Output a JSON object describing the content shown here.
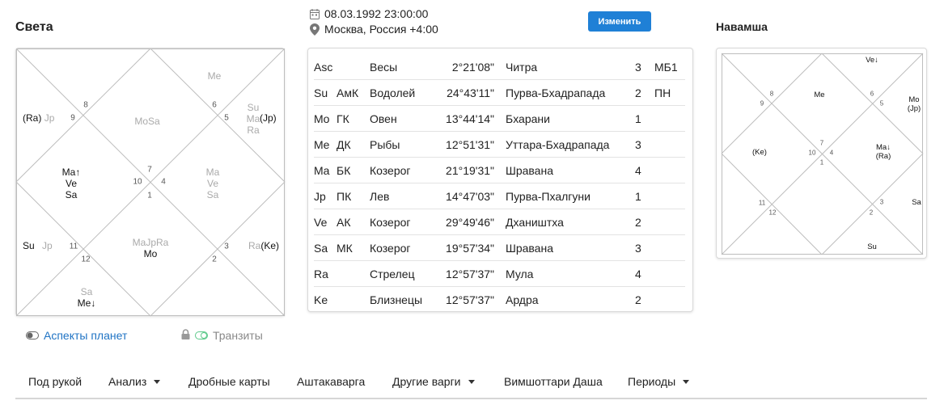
{
  "rasi": {
    "title": "Света",
    "houses": [
      {
        "num": "1",
        "planets": [
          {
            "t": "Ma↑",
            "dim": false
          },
          {
            "t": "Ve",
            "dim": false
          },
          {
            "t": "Sa",
            "dim": false
          }
        ]
      },
      {
        "num": "2",
        "planets": []
      },
      {
        "num": "3",
        "planets": []
      },
      {
        "num": "4",
        "planets": [
          {
            "t": "Ma",
            "dim": true
          },
          {
            "t": "Ve",
            "dim": true
          },
          {
            "t": "Sa",
            "dim": true
          }
        ]
      },
      {
        "num": "5",
        "planets": [
          {
            "t": "Su",
            "dim": true
          },
          {
            "t": "Ma",
            "dim": true
          },
          {
            "t": "Ra",
            "dim": true
          }
        ]
      },
      {
        "num": "6",
        "planets": [
          {
            "t": "Me",
            "dim": true
          }
        ]
      },
      {
        "num": "7",
        "planets": [
          {
            "t": "MoSa",
            "dim": true
          }
        ]
      },
      {
        "num": "8",
        "planets": []
      },
      {
        "num": "9",
        "planets": []
      },
      {
        "num": "10",
        "planets": []
      },
      {
        "num": "11",
        "planets": []
      },
      {
        "num": "12",
        "planets": [
          {
            "t": "Sa",
            "dim": true
          },
          {
            "t": "Me↓",
            "dim": false
          }
        ]
      },
      {
        "num": "",
        "planets": [
          {
            "t": "MaJpRa",
            "dim": true
          },
          {
            "t": "Mo",
            "dim": false
          }
        ]
      }
    ],
    "side": {
      "l1": "(Ra)",
      "l1b": "Jp",
      "r1": "(Jp)",
      "l2": "Su",
      "l2b": "Jp",
      "r2a": "Ra",
      "r2": "(Ke)"
    }
  },
  "birth": {
    "datetime": "08.03.1992 23:00:00",
    "place": "Москва, Россия +4:00",
    "change_label": "Изменить"
  },
  "planets_table": [
    {
      "code": "Asc",
      "karaka": "",
      "sign": "Весы",
      "degree": "2°21'08\"",
      "nakshatra": "Читра",
      "pada": "3",
      "status": "МБ1"
    },
    {
      "code": "Su",
      "karaka": "АмК",
      "sign": "Водолей",
      "degree": "24°43'11\"",
      "nakshatra": "Пурва-Бхадрапада",
      "pada": "2",
      "status": "ПН"
    },
    {
      "code": "Mo",
      "karaka": "ГК",
      "sign": "Овен",
      "degree": "13°44'14\"",
      "nakshatra": "Бхарани",
      "pada": "1",
      "status": ""
    },
    {
      "code": "Me",
      "karaka": "ДК",
      "sign": "Рыбы",
      "degree": "12°51'31\"",
      "nakshatra": "Уттара-Бхадрапада",
      "pada": "3",
      "status": ""
    },
    {
      "code": "Ma",
      "karaka": "БК",
      "sign": "Козерог",
      "degree": "21°19'31\"",
      "nakshatra": "Шравана",
      "pada": "4",
      "status": ""
    },
    {
      "code": "Jp",
      "karaka": "ПК",
      "sign": "Лев",
      "degree": "14°47'03\"",
      "nakshatra": "Пурва-Пхалгуни",
      "pada": "1",
      "status": ""
    },
    {
      "code": "Ve",
      "karaka": "АК",
      "sign": "Козерог",
      "degree": "29°49'46\"",
      "nakshatra": "Дхаништха",
      "pada": "2",
      "status": ""
    },
    {
      "code": "Sa",
      "karaka": "МК",
      "sign": "Козерог",
      "degree": "19°57'34\"",
      "nakshatra": "Шравана",
      "pada": "3",
      "status": ""
    },
    {
      "code": "Ra",
      "karaka": "",
      "sign": "Стрелец",
      "degree": "12°57'37\"",
      "nakshatra": "Мула",
      "pada": "4",
      "status": ""
    },
    {
      "code": "Ke",
      "karaka": "",
      "sign": "Близнецы",
      "degree": "12°57'37\"",
      "nakshatra": "Ардра",
      "pada": "2",
      "status": ""
    }
  ],
  "navamsa": {
    "title": "Навамша",
    "h1": "(Ke)",
    "h4a": "Ma↓",
    "h4b": "(Ra)",
    "h6": "Me",
    "top": "Ve↓",
    "r1a": "Mo",
    "r1b": "(Jp)",
    "r2": "Sa",
    "bottom": "Su",
    "nums": [
      "10",
      "1",
      "4",
      "7",
      "8",
      "9",
      "5",
      "6",
      "11",
      "12",
      "3",
      "2"
    ]
  },
  "toggles": {
    "aspects": "Аспекты планет",
    "transits": "Транзиты"
  },
  "nav": [
    "Под рукой",
    "Анализ",
    "Дробные карты",
    "Аштакаварга",
    "Другие варги",
    "Вимшоттари Даша",
    "Периоды"
  ],
  "colors": {
    "accent": "#1f80d6",
    "link": "#1f73c4",
    "toggle_on": "#5cc98a"
  }
}
